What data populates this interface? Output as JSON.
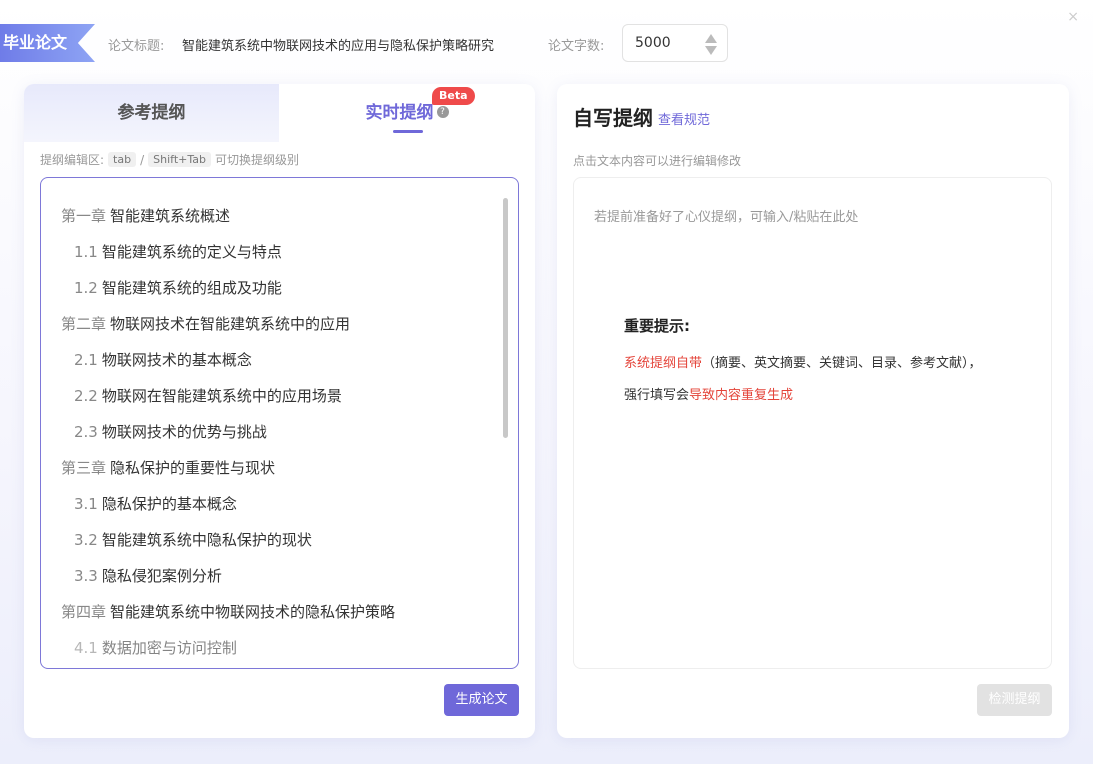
{
  "header": {
    "badge": "毕业论文",
    "title_label": "论文标题:",
    "title_value": "智能建筑系统中物联网技术的应用与隐私保护策略研究",
    "count_label": "论文字数:",
    "count_value": "5000",
    "close_glyph": "×"
  },
  "left_panel": {
    "tab_reference": "参考提纲",
    "tab_live": "实时提纲",
    "help_glyph": "?",
    "beta": "Beta",
    "hint_prefix": "提纲编辑区:",
    "key_tab": "tab",
    "slash": "/",
    "key_shift_tab": "Shift+Tab",
    "hint_suffix": "可切换提纲级别",
    "outline": [
      {
        "no": "第一章",
        "text": "智能建筑系统概述",
        "level": 1
      },
      {
        "no": "1.1",
        "text": "智能建筑系统的定义与特点",
        "level": 2
      },
      {
        "no": "1.2",
        "text": "智能建筑系统的组成及功能",
        "level": 2
      },
      {
        "no": "第二章",
        "text": "物联网技术在智能建筑系统中的应用",
        "level": 1
      },
      {
        "no": "2.1",
        "text": "物联网技术的基本概念",
        "level": 2
      },
      {
        "no": "2.2",
        "text": "物联网在智能建筑系统中的应用场景",
        "level": 2
      },
      {
        "no": "2.3",
        "text": "物联网技术的优势与挑战",
        "level": 2
      },
      {
        "no": "第三章",
        "text": "隐私保护的重要性与现状",
        "level": 1
      },
      {
        "no": "3.1",
        "text": "隐私保护的基本概念",
        "level": 2
      },
      {
        "no": "3.2",
        "text": "智能建筑系统中隐私保护的现状",
        "level": 2
      },
      {
        "no": "3.3",
        "text": "隐私侵犯案例分析",
        "level": 2
      },
      {
        "no": "第四章",
        "text": "智能建筑系统中物联网技术的隐私保护策略",
        "level": 1
      },
      {
        "no": "4.1",
        "text": "数据加密与访问控制",
        "level": 2
      }
    ],
    "generate_button": "生成论文"
  },
  "right_panel": {
    "title": "自写提纲",
    "link": "查看规范",
    "hint": "点击文本内容可以进行编辑修改",
    "placeholder": "若提前准备好了心仪提纲，可输入/粘贴在此处",
    "notice_title": "重要提示:",
    "notice1_red": "系统提纲自带",
    "notice1_rest": "（摘要、英文摘要、关键词、目录、参考文献），",
    "notice2_start": "强行填写会",
    "notice2_red": "导致内容重复生成",
    "check_button": "检测提纲"
  }
}
